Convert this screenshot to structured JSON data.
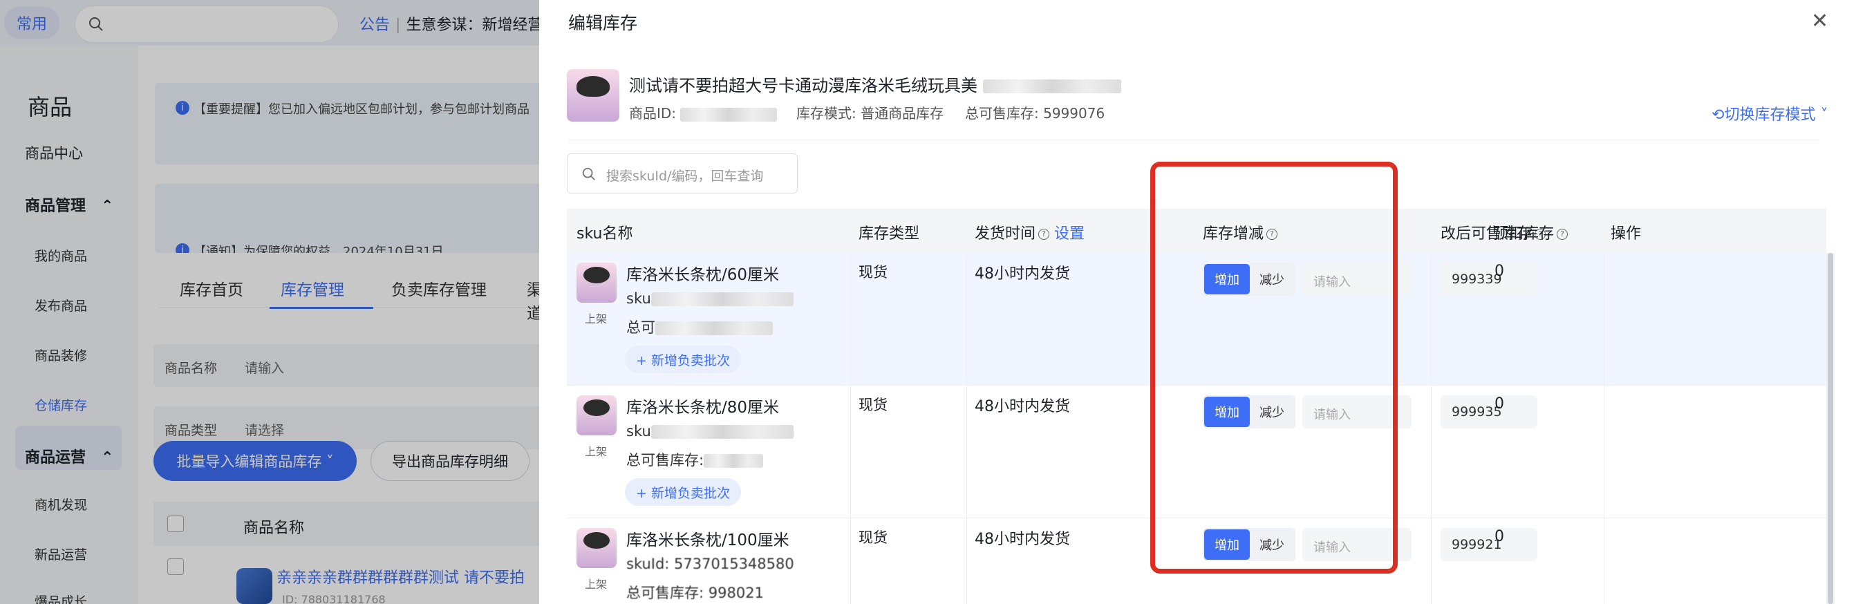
{
  "background": {
    "topbar": {
      "common_label": "常用",
      "notice_tag": "公告",
      "notice_text": "生意参谋：新增经营"
    },
    "sidebar": {
      "title": "商品",
      "center": "商品中心",
      "group_manage": "商品管理",
      "my_goods": "我的商品",
      "publish": "发布商品",
      "decorate": "商品装修",
      "warehouse": "仓储库存",
      "group_ops": "商品运营",
      "opportunity": "商机发现",
      "new_ops": "新品运营",
      "growth": "爆品成长"
    },
    "alerts": [
      {
        "text": "【重要提醒】您已加入偏远地区包邮计划，参与包邮计划商品"
      },
      {
        "text": "【通知】为保障您的权益，2024年10月31日"
      }
    ],
    "tabs": [
      "库存首页",
      "库存管理",
      "负卖库存管理",
      "渠道"
    ],
    "filters": {
      "name_label": "商品名称",
      "name_placeholder": "请输入",
      "type_label": "商品类型",
      "type_placeholder": "请选择"
    },
    "buttons": {
      "batch": "批量导入编辑商品库存 ˅",
      "export": "导出商品库存明细"
    },
    "table": {
      "header": "商品名称",
      "product_name": "亲亲亲亲群群群群群群测试 请不要拍",
      "product_id": "ID: 788031181768"
    }
  },
  "panel": {
    "title": "编辑库存",
    "product": {
      "name": "测试请不要拍超大号卡通动漫库洛米毛绒玩具美",
      "id_label": "商品ID:",
      "mode_label": "库存模式: 普通商品库存",
      "total_label": "总可售库存: 5999076",
      "switch_label": "切换库存模式"
    },
    "search_placeholder": "搜索skuId/编码，回车查询",
    "columns": {
      "sku": "sku名称",
      "type": "库存类型",
      "ship": "发货时间",
      "ship_link": "设置",
      "change": "库存增减",
      "after": "改后可售库存",
      "pre": "预扣库存",
      "op": "操作"
    },
    "rows": [
      {
        "name": "库洛米长条枕/60厘米",
        "sku": "sku",
        "total": "总可",
        "state": "上架",
        "add_batch": "+ 新增负卖批次",
        "type": "现货",
        "ship": "48小时内发货",
        "inc": "增加",
        "dec": "减少",
        "input_placeholder": "请输入",
        "after": "999339",
        "pre": "0"
      },
      {
        "name": "库洛米长条枕/80厘米",
        "sku": "sku",
        "total": "总可售库存:",
        "state": "上架",
        "add_batch": "+ 新增负卖批次",
        "type": "现货",
        "ship": "48小时内发货",
        "inc": "增加",
        "dec": "减少",
        "input_placeholder": "请输入",
        "after": "999935",
        "pre": "0"
      },
      {
        "name": "库洛米长条枕/100厘米",
        "sku": "skuId: 5737015348580",
        "total": "总可售库存: 998021",
        "state": "上架",
        "type": "现货",
        "ship": "48小时内发货",
        "inc": "增加",
        "dec": "减少",
        "input_placeholder": "请输入",
        "after": "999921",
        "pre": "0"
      }
    ]
  },
  "colors": {
    "accent": "#3d6ef5",
    "highlight_box": "#e02d22"
  }
}
